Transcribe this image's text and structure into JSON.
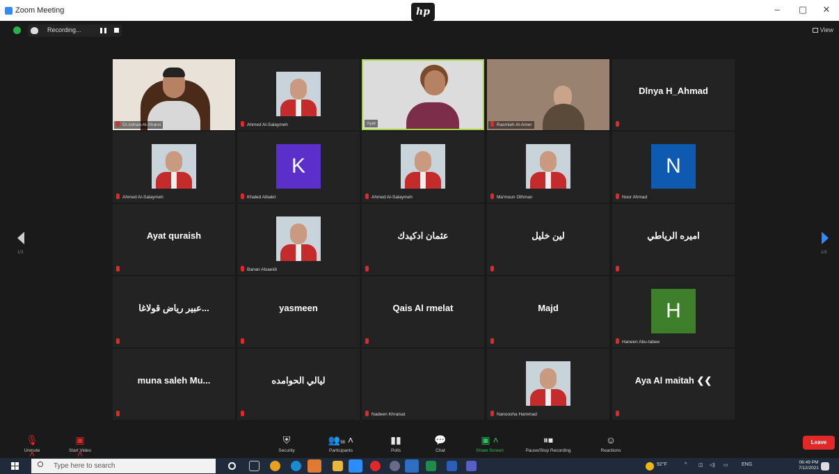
{
  "window": {
    "title": "Zoom Meeting",
    "brand_logo": "hp",
    "controls": [
      "–",
      "▢",
      "✕"
    ]
  },
  "meeting_bar": {
    "recording_label": "Recording...",
    "view_label": "View"
  },
  "navigation": {
    "page_left": "1/3",
    "page_right": "1/3"
  },
  "tiles": [
    {
      "name": "Dr.Adnan Al-Sharei",
      "kind": "video",
      "muted": true
    },
    {
      "name": "Ahmed Al-Salaymeh",
      "kind": "photo",
      "muted": true
    },
    {
      "name": "Ayat",
      "kind": "video-speaking",
      "muted": false
    },
    {
      "name": "Rasmieh Al-Amer",
      "kind": "video",
      "muted": true
    },
    {
      "name": "Dlnya H_Ahmad",
      "kind": "name",
      "muted": true
    },
    {
      "name": "Ahmed Al-Salaymeh",
      "kind": "photo",
      "muted": true
    },
    {
      "name": "Khaled Albakri",
      "kind": "letter",
      "letter": "K",
      "color": "#5b2fc9",
      "muted": true
    },
    {
      "name": "Ahmed Al-Salaymeh",
      "kind": "photo",
      "muted": true
    },
    {
      "name": "Ma'moun Othman",
      "kind": "photo",
      "muted": true
    },
    {
      "name": "Noor Ahmad",
      "kind": "letter",
      "letter": "N",
      "color": "#0e5ab0",
      "muted": true
    },
    {
      "name": "Ayat quraish",
      "kind": "name",
      "muted": true
    },
    {
      "name": "Banan Alsaeidi",
      "kind": "photo",
      "muted": true
    },
    {
      "name": "عثمان ادكيدك",
      "kind": "name",
      "muted": true
    },
    {
      "name": "لين خليل",
      "kind": "name",
      "muted": true
    },
    {
      "name": "اميره الرياطي",
      "kind": "name",
      "muted": true
    },
    {
      "name": "عبير رياض قولاغا...",
      "kind": "name",
      "muted": true
    },
    {
      "name": "yasmeen",
      "kind": "name",
      "muted": true
    },
    {
      "name": "Qais Al rmelat",
      "kind": "name",
      "muted": true
    },
    {
      "name": "Majd",
      "kind": "name",
      "muted": true
    },
    {
      "name": "Haneen Abu-tabee",
      "kind": "letter",
      "letter": "H",
      "color": "#3d7f2b",
      "muted": true
    },
    {
      "name": "muna saleh Mu...",
      "kind": "name",
      "muted": true
    },
    {
      "name": "ليالي الحوامده",
      "kind": "name",
      "muted": true
    },
    {
      "name": "Nadeen Khraisat",
      "kind": "blank",
      "muted": true
    },
    {
      "name": "Nanoosha Hammad",
      "kind": "photo",
      "muted": true
    },
    {
      "name": "Aya Al maitah ❮❮",
      "kind": "name",
      "muted": true
    }
  ],
  "toolbar": {
    "unmute": "Unmute",
    "start_video": "Start Video",
    "security": "Security",
    "participants": "Participants",
    "participants_count": "58",
    "polls": "Polls",
    "chat": "Chat",
    "share_screen": "Share Screen",
    "pause_recording": "Pause/Stop Recording",
    "reactions": "Reactions",
    "leave": "Leave"
  },
  "taskbar": {
    "search_placeholder": "Type here to search",
    "weather": "92°F",
    "language": "ENG",
    "time": "06:49 PM",
    "date": "7/12/2021"
  },
  "colors": {
    "speaking_border": "#a5d43c",
    "leave": "#e02828",
    "accent": "#2d8cff",
    "share": "#27c25a"
  }
}
